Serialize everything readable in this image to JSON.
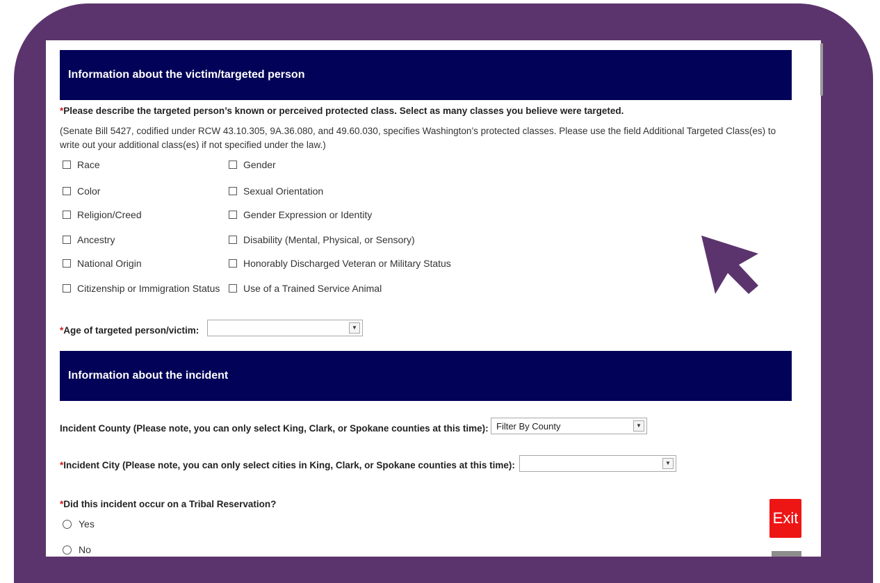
{
  "section_victim": {
    "title": "Information about the victim/targeted person",
    "protected_class_question": {
      "required_mark": "*",
      "label": "Please describe the targeted person’s known or perceived protected class. Select as many classes you believe were targeted.",
      "note": "(Senate Bill 5427, codified under RCW 43.10.305, 9A.36.080, and 49.60.030, specifies Washington’s protected classes. Please use the field Additional Targeted Class(es) to write out your additional class(es) if not specified under the law.)"
    },
    "classes_col1": [
      "Race",
      "Color",
      "Religion/Creed",
      "Ancestry",
      "National Origin",
      "Citizenship or Immigration Status"
    ],
    "classes_col2": [
      "Gender",
      "Sexual Orientation",
      "Gender Expression or Identity",
      "Disability (Mental, Physical, or Sensory)",
      "Honorably Discharged Veteran or Military Status",
      "Use of a Trained Service Animal"
    ],
    "age_question": {
      "required_mark": "*",
      "label": "Age of targeted person/victim:",
      "value": ""
    }
  },
  "section_incident": {
    "title": "Information about the incident",
    "county": {
      "label": "Incident County (Please note, you can only select King, Clark, or Spokane counties at this time):",
      "value": "Filter By County"
    },
    "city": {
      "required_mark": "*",
      "label": "Incident City (Please note, you can only select cities in King, Clark, or Spokane counties at this time):",
      "value": ""
    },
    "tribal": {
      "required_mark": "*",
      "label": "Did this incident occur on a Tribal Reservation?",
      "options": [
        "Yes",
        "No"
      ]
    }
  },
  "exit_button": {
    "label": "Exit",
    "color": "#ee1515"
  },
  "colors": {
    "frame": "#5c346d",
    "section_bar": "#020258",
    "required": "#d11c1c"
  },
  "icons": {
    "cursor": "arrow-cursor-icon",
    "dropdown": "triangle-down-icon"
  }
}
